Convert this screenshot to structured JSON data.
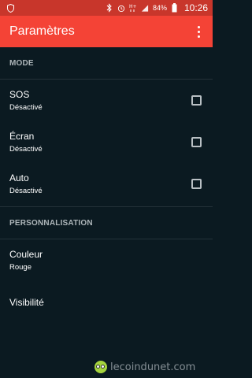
{
  "statusbar": {
    "left_icons": [
      "shield-icon"
    ],
    "right_icons": [
      "bluetooth-icon",
      "alarm-icon",
      "hplus-signal-icon",
      "cell-signal-icon",
      "battery-icon"
    ],
    "battery_percent": "84%",
    "time": "10:26"
  },
  "appbar": {
    "title": "Paramètres",
    "overflow_icon": "more-vert-icon"
  },
  "sections": {
    "mode": {
      "header": "MODE",
      "items": [
        {
          "title": "SOS",
          "summary": "Désactivé",
          "checked": false
        },
        {
          "title": "Écran",
          "summary": "Désactivé",
          "checked": false
        },
        {
          "title": "Auto",
          "summary": "Désactivé",
          "checked": false
        }
      ]
    },
    "personnalisation": {
      "header": "PERSONNALISATION",
      "items": [
        {
          "title": "Couleur",
          "summary": "Rouge"
        },
        {
          "title": "Visibilité"
        }
      ]
    }
  },
  "watermark": {
    "text": "lecoindunet.com",
    "logo": "owl-logo"
  },
  "colors": {
    "statusbar": "#c8362b",
    "appbar": "#f44336",
    "background": "#0b1a21",
    "header_text": "#aeb6ba"
  }
}
